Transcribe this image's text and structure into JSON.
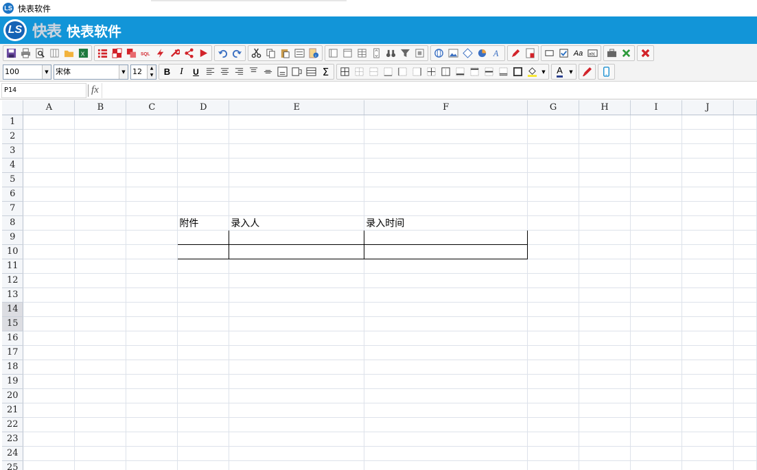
{
  "window": {
    "title": "快表软件",
    "app_icon": "LS"
  },
  "banner": {
    "logo_mark": "快表",
    "logo_letters": "LS",
    "app_name": "快表软件",
    "brand_color": "#1295d8"
  },
  "format_bar": {
    "zoom": "100",
    "font_family": "宋体",
    "font_size": "12",
    "bold_label": "B",
    "italic_label": "I",
    "underline_label": "U",
    "sum_label": "Σ",
    "font_color_label": "A",
    "textbox_label": "Aa"
  },
  "formula_bar": {
    "cell_ref": "P14",
    "fx_label": "fx",
    "content": ""
  },
  "sheet": {
    "columns": [
      {
        "label": "A"
      },
      {
        "label": "B"
      },
      {
        "label": "C"
      },
      {
        "label": "D"
      },
      {
        "label": "E"
      },
      {
        "label": "F"
      },
      {
        "label": "G"
      },
      {
        "label": "H"
      },
      {
        "label": "I"
      },
      {
        "label": "J"
      }
    ],
    "rows": [
      "1",
      "2",
      "3",
      "4",
      "5",
      "6",
      "7",
      "8",
      "9",
      "10",
      "11",
      "12",
      "13",
      "14",
      "15",
      "16",
      "17",
      "18",
      "19",
      "20",
      "21",
      "22",
      "23",
      "24",
      "25"
    ],
    "selected_rows": [
      "14",
      "15"
    ],
    "cells": {
      "D8": "附件",
      "E8": "录入人",
      "F8": "录入时间"
    }
  }
}
